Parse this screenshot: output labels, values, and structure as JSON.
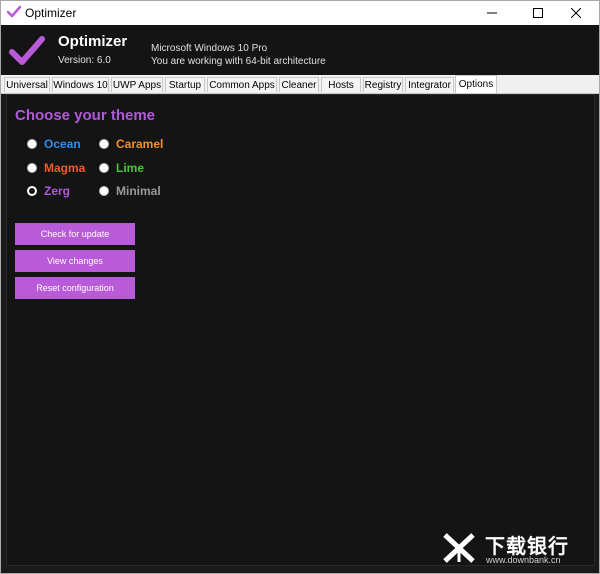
{
  "window": {
    "title": "Optimizer"
  },
  "header": {
    "app_name": "Optimizer",
    "version": "Version: 6.0",
    "os_name": "Microsoft Windows 10 Pro",
    "architecture": "You are working with 64-bit architecture"
  },
  "tabs": [
    {
      "label": "Universal",
      "active": false
    },
    {
      "label": "Windows 10",
      "active": false
    },
    {
      "label": "UWP Apps",
      "active": false
    },
    {
      "label": "Startup",
      "active": false
    },
    {
      "label": "Common Apps",
      "active": false
    },
    {
      "label": "Cleaner",
      "active": false
    },
    {
      "label": "Hosts",
      "active": false
    },
    {
      "label": "Registry",
      "active": false
    },
    {
      "label": "Integrator",
      "active": false
    },
    {
      "label": "Options",
      "active": true
    }
  ],
  "options": {
    "section_title": "Choose your theme",
    "themes": [
      {
        "label": "Ocean",
        "color": "#2d8ff0",
        "checked": false
      },
      {
        "label": "Caramel",
        "color": "#f08f2d",
        "checked": false
      },
      {
        "label": "Magma",
        "color": "#f05a2d",
        "checked": false
      },
      {
        "label": "Lime",
        "color": "#4cc43a",
        "checked": false
      },
      {
        "label": "Zerg",
        "color": "#b05ad9",
        "checked": true
      },
      {
        "label": "Minimal",
        "color": "#9a9a9a",
        "checked": false
      }
    ],
    "buttons": {
      "check_update": "Check for update",
      "view_changes": "View changes",
      "reset": "Reset configuration"
    }
  },
  "accent_color": "#b95ad8",
  "watermark": {
    "brand": "下载银行",
    "url": "www.downbank.cn"
  }
}
